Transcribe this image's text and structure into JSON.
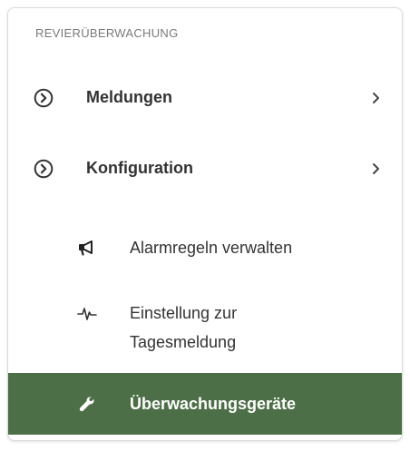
{
  "section": {
    "title": "REVIERÜBERWACHUNG"
  },
  "nav": {
    "items": [
      {
        "label": "Meldungen",
        "icon": "chevron-circle-icon",
        "expand_icon": "chevron-right-icon"
      },
      {
        "label": "Konfiguration",
        "icon": "chevron-circle-icon",
        "expand_icon": "chevron-right-icon"
      }
    ]
  },
  "sub": {
    "items": [
      {
        "label": "Alarmregeln verwalten",
        "icon": "megaphone-icon"
      },
      {
        "label_line1": "Einstellung zur",
        "label_line2": "Tagesmeldung",
        "icon": "activity-icon"
      },
      {
        "label": "Überwachungsgeräte",
        "icon": "wrench-icon",
        "active": true
      }
    ]
  },
  "colors": {
    "active_bg": "#4d6f47",
    "text": "#333333",
    "section_title": "#7a7a7a"
  }
}
